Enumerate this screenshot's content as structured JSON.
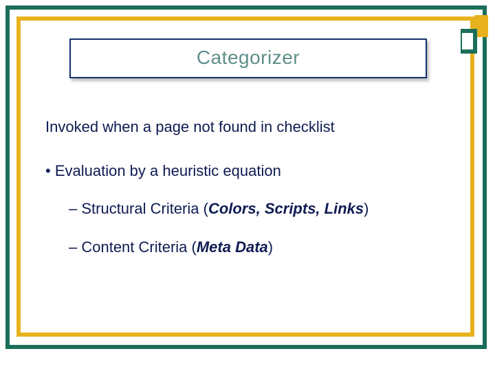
{
  "title": "Categorizer",
  "lead": "Invoked when a page not found in checklist",
  "bullet1_prefix": "•  ",
  "bullet1": "Evaluation by a heuristic equation",
  "sub1_prefix": "– Structural Criteria (",
  "sub1_em": "Colors, Scripts, Links",
  "sub1_suffix": ")",
  "sub2_prefix": "– Content Criteria (",
  "sub2_em": "Meta Data",
  "sub2_suffix": ")"
}
